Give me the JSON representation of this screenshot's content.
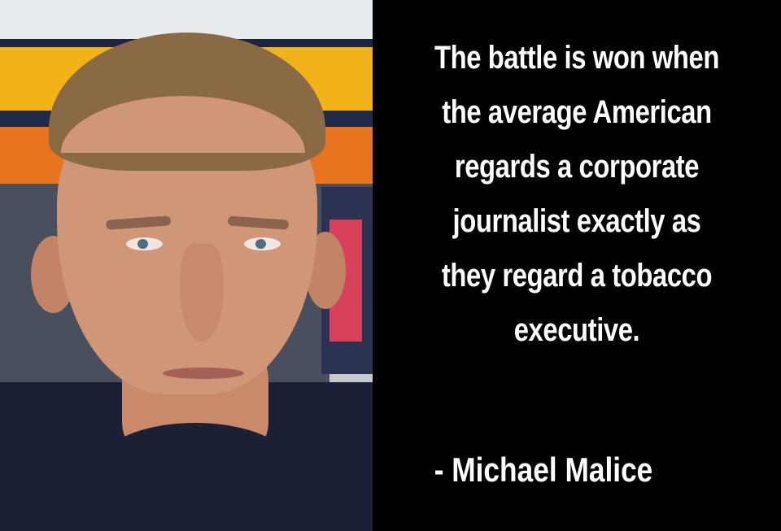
{
  "photo": {
    "cap_logo_text": ""
  },
  "quote": {
    "lines": [
      "The battle is won when",
      "the average American",
      "regards a corporate",
      "journalist exactly as",
      "they regard a tobacco",
      "executive."
    ],
    "attribution": "- Michael Malice"
  },
  "colors": {
    "background": "#000000",
    "text": "#ffffff"
  }
}
